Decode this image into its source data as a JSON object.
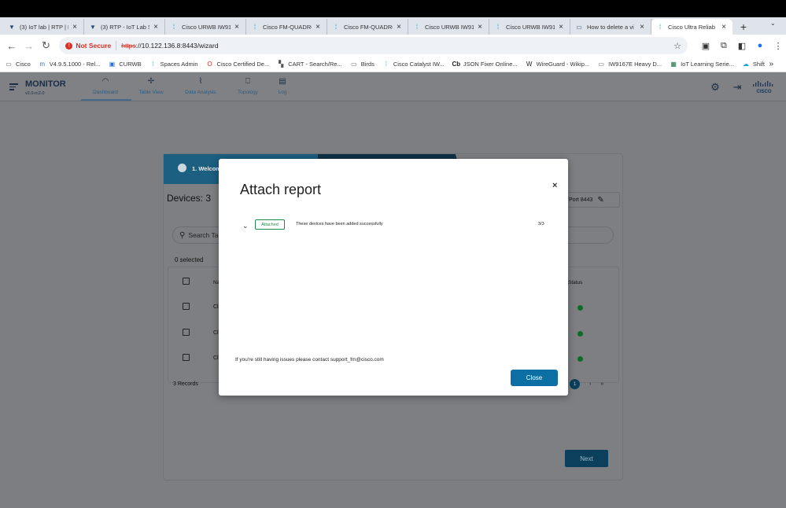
{
  "browser": {
    "tabs": [
      {
        "title": "(3) IoT lab | RTP | L",
        "icon": "vlab-icon"
      },
      {
        "title": "(3) RTP - IoT Lab S",
        "icon": "vlab-icon"
      },
      {
        "title": "Cisco URWB IW916",
        "icon": "cisco-icon"
      },
      {
        "title": "Cisco FM-QUADRO",
        "icon": "cisco-icon"
      },
      {
        "title": "Cisco FM-QUADRO",
        "icon": "cisco-icon"
      },
      {
        "title": "Cisco URWB IW916",
        "icon": "cisco-icon"
      },
      {
        "title": "Cisco URWB IW916",
        "icon": "cisco-icon"
      },
      {
        "title": "How to delete a vi",
        "icon": "page-icon"
      },
      {
        "title": "Cisco Ultra Reliab",
        "icon": "cisco-icon",
        "active": true
      }
    ],
    "security": "Not Secure",
    "url_protocol": "https",
    "url_rest": "://10.122.136.8:8443/wizard",
    "bookmarks": [
      {
        "label": "Cisco",
        "icon": "folder-icon"
      },
      {
        "label": "V4.9.5.1000 - Rel...",
        "icon": "m-icon"
      },
      {
        "label": "CURWB",
        "icon": "ep-icon"
      },
      {
        "label": "Spaces Admin",
        "icon": "cisco-icon"
      },
      {
        "label": "Cisco Certified De...",
        "icon": "oracle-icon"
      },
      {
        "label": "CART - Search/Re...",
        "icon": "cart-icon"
      },
      {
        "label": "Birds",
        "icon": "folder-icon"
      },
      {
        "label": "Cisco Catalyst IW...",
        "icon": "cisco-icon"
      },
      {
        "label": "JSON Fixer Online...",
        "icon": "cb-icon"
      },
      {
        "label": "WireGuard - Wikip...",
        "icon": "wikipedia-icon"
      },
      {
        "label": "IW9167E Heavy D...",
        "icon": "page-icon"
      },
      {
        "label": "IoT Learning Serie...",
        "icon": "excel-icon"
      },
      {
        "label": "Shift",
        "icon": "cloud-icon"
      }
    ]
  },
  "app": {
    "brand": "MONITOR",
    "version": "v2.0-rc2.0",
    "nav": [
      "Dashboard",
      "Table View",
      "Data Analysis",
      "Topology",
      "Log"
    ]
  },
  "wizard": {
    "step1": "1. Welcom",
    "devices_title": "Devices: 3",
    "port": "Port 8443",
    "search_placeholder": "Search Ta",
    "selected": "0 selected",
    "col_name": "Na",
    "col_status": "Status",
    "row_prefix": "Cl",
    "records": "3 Records",
    "page": "1",
    "next": "Next"
  },
  "modal": {
    "title": "Attach report",
    "close_symbol": "×",
    "badge": "Attached",
    "message": "These devices have been added successfully",
    "count": "3/3",
    "support": "If you're still having issues please contact support_fm@cisco.com",
    "close_button": "Close"
  },
  "colors": {
    "accent": "#0b6fa4",
    "success": "#1f8a47",
    "danger": "#d93025"
  }
}
